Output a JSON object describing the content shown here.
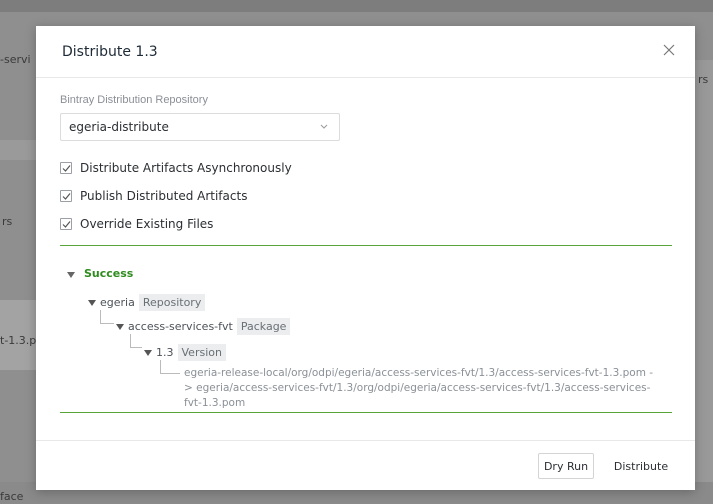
{
  "background": {
    "texts": [
      "-servi",
      "rs",
      "rs",
      "t-1.3.p",
      "face"
    ]
  },
  "modal": {
    "title": "Distribute 1.3",
    "close_glyph": "×",
    "repository_label": "Bintray Distribution Repository",
    "repository_value": "egeria-distribute",
    "options": [
      {
        "label": "Distribute Artifacts Asynchronously",
        "checked": true
      },
      {
        "label": "Publish Distributed Artifacts",
        "checked": true
      },
      {
        "label": "Override Existing Files",
        "checked": true
      }
    ],
    "result": {
      "status": "Success",
      "repository": {
        "name": "egeria",
        "tag": "Repository"
      },
      "package": {
        "name": "access-services-fvt",
        "tag": "Package"
      },
      "version": {
        "name": "1.3",
        "tag": "Version"
      },
      "path": "egeria-release-local/org/odpi/egeria/access-services-fvt/1.3/access-services-fvt-1.3.pom -> egeria/access-services-fvt/1.3/org/odpi/egeria/access-services-fvt/1.3/access-services-fvt-1.3.pom"
    },
    "buttons": {
      "dry_run": "Dry Run",
      "distribute": "Distribute"
    }
  },
  "colors": {
    "success": "#2e8b1e",
    "divider": "#5aa53a"
  },
  "icons": {
    "close": "close-icon",
    "chevron": "chevron-down-icon",
    "check": "check-icon",
    "expand": "caret-down-icon"
  }
}
